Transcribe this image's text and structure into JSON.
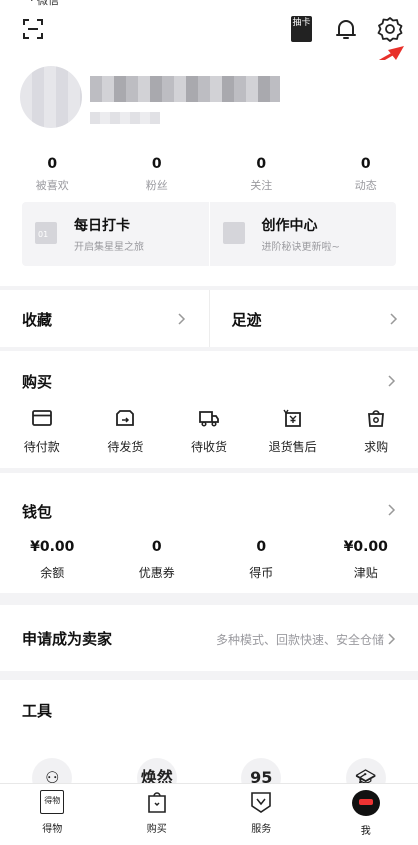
{
  "status": {
    "text": "· 微信"
  },
  "header": {
    "draw_card_label": "抽卡"
  },
  "stats": [
    {
      "value": "0",
      "label": "被喜欢"
    },
    {
      "value": "0",
      "label": "粉丝"
    },
    {
      "value": "0",
      "label": "关注"
    },
    {
      "value": "0",
      "label": "动态"
    }
  ],
  "cards": [
    {
      "icon_text": "01",
      "title": "每日打卡",
      "subtitle": "开启集星星之旅"
    },
    {
      "icon_text": "",
      "title": "创作中心",
      "subtitle": "进阶秘诀更新啦~"
    }
  ],
  "favorites": {
    "label": "收藏"
  },
  "footprints": {
    "label": "足迹"
  },
  "buy": {
    "title": "购买",
    "items": [
      {
        "label": "待付款"
      },
      {
        "label": "待发货"
      },
      {
        "label": "待收货"
      },
      {
        "label": "退货售后"
      },
      {
        "label": "求购"
      }
    ]
  },
  "wallet": {
    "title": "钱包",
    "items": [
      {
        "value": "¥0.00",
        "label": "余额"
      },
      {
        "value": "0",
        "label": "优惠券"
      },
      {
        "value": "0",
        "label": "得币"
      },
      {
        "value": "¥0.00",
        "label": "津贴"
      }
    ]
  },
  "seller": {
    "title": "申请成为卖家",
    "subtitle": "多种模式、回款快速、安全仓储"
  },
  "tools": {
    "title": "工具",
    "items": [
      "",
      "焕然",
      "95",
      ""
    ]
  },
  "tabbar": {
    "items": [
      {
        "label": "得物",
        "icon_text": "得物"
      },
      {
        "label": "购买",
        "icon_text": ""
      },
      {
        "label": "服务",
        "icon_text": ""
      },
      {
        "label": "我",
        "icon_text": ""
      }
    ]
  },
  "colors": {
    "accent_arrow": "#e8302a",
    "background": "#f3f3f5"
  }
}
